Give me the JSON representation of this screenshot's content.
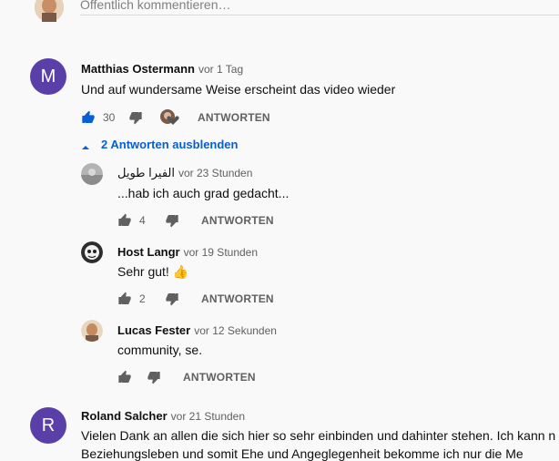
{
  "input": {
    "placeholder": "Öffentlich kommentieren…"
  },
  "comments": [
    {
      "avatar_letter": "M",
      "avatar_color": "#5a3fa8",
      "author": "Matthias Ostermann",
      "time": "vor 1 Tag",
      "text": "Und auf wundersame Weise erscheint das video wieder",
      "likes": "30",
      "reply_label": "ANTWORTEN",
      "toggle_label": "2 Antworten ausblenden"
    },
    {
      "avatar_letter": "R",
      "avatar_color": "#5a3fa8",
      "author": "Roland Salcher",
      "time": "vor 21 Stunden",
      "text": "Vielen Dank an allen die sich hier so sehr einbinden und dahinter stehen. Ich kann n",
      "text2": "Beziehungsleben und somit Ehe und Angeglegenheit bekomme ich nur die Me"
    }
  ],
  "replies": [
    {
      "author": "الفيرا طويل",
      "time": "vor 23 Stunden",
      "text": "...hab ich auch grad gedacht...",
      "likes": "4",
      "reply_label": "ANTWORTEN"
    },
    {
      "author": "Host Langr",
      "time": "vor 19 Stunden",
      "text": "Sehr gut! 👍",
      "likes": "2",
      "reply_label": "ANTWORTEN"
    },
    {
      "author": "Lucas Fester",
      "time": "vor 12 Sekunden",
      "text": "community, se.",
      "likes": "",
      "reply_label": "ANTWORTEN"
    }
  ],
  "colors": {
    "accent": "#065fd4",
    "like_active": "#065fd4"
  }
}
